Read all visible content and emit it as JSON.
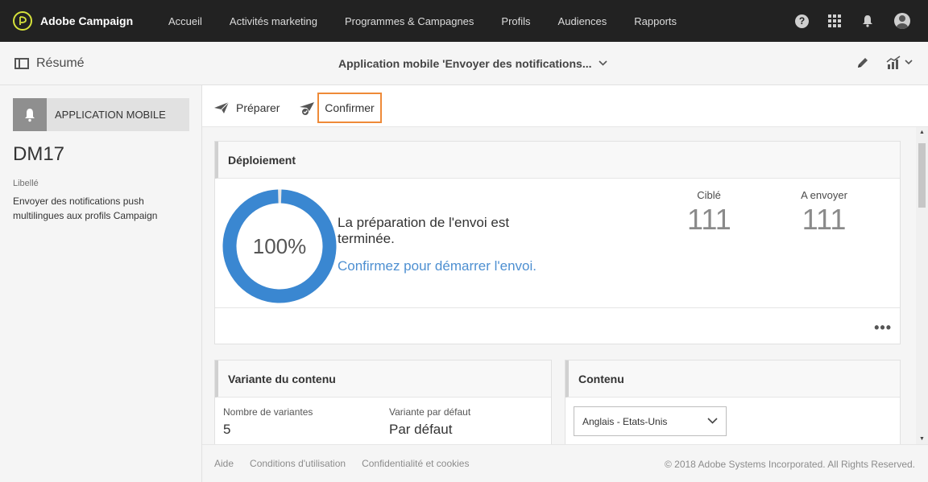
{
  "brand": {
    "name": "Adobe Campaign"
  },
  "nav": {
    "items": [
      "Accueil",
      "Activités marketing",
      "Programmes & Campagnes",
      "Profils",
      "Audiences",
      "Rapports"
    ],
    "help_label": "?"
  },
  "subheader": {
    "summary_label": "Résumé",
    "title": "Application mobile 'Envoyer des notifications..."
  },
  "left": {
    "app_label": "APPLICATION MOBILE",
    "code": "DM17",
    "label_title": "Libellé",
    "label_value": "Envoyer des notifications push multilingues aux profils Campaign"
  },
  "actions": {
    "prepare": "Préparer",
    "confirm": "Confirmer"
  },
  "deploy": {
    "title": "Déploiement",
    "progress_percent": 100,
    "progress_label": "100%",
    "message": "La préparation de l'envoi est terminée.",
    "link": "Confirmez pour démarrer l'envoi.",
    "targeted_label": "Ciblé",
    "targeted_value": "111",
    "tosend_label": "A envoyer",
    "tosend_value": "111",
    "more": "•••"
  },
  "variant": {
    "title": "Variante du contenu",
    "count_label": "Nombre de variantes",
    "count_value": "5",
    "default_label": "Variante par défaut",
    "default_value": "Par défaut"
  },
  "content": {
    "title": "Contenu",
    "selected_language": "Anglais - Etats-Unis"
  },
  "footer": {
    "links": [
      "Aide",
      "Conditions d'utilisation",
      "Confidentialité et cookies"
    ],
    "copyright": "© 2018 Adobe Systems Incorporated. All Rights Reserved."
  },
  "colors": {
    "accent_blue": "#3a87d1",
    "highlight_orange": "#ee8a38",
    "nav_bg": "#222222"
  }
}
